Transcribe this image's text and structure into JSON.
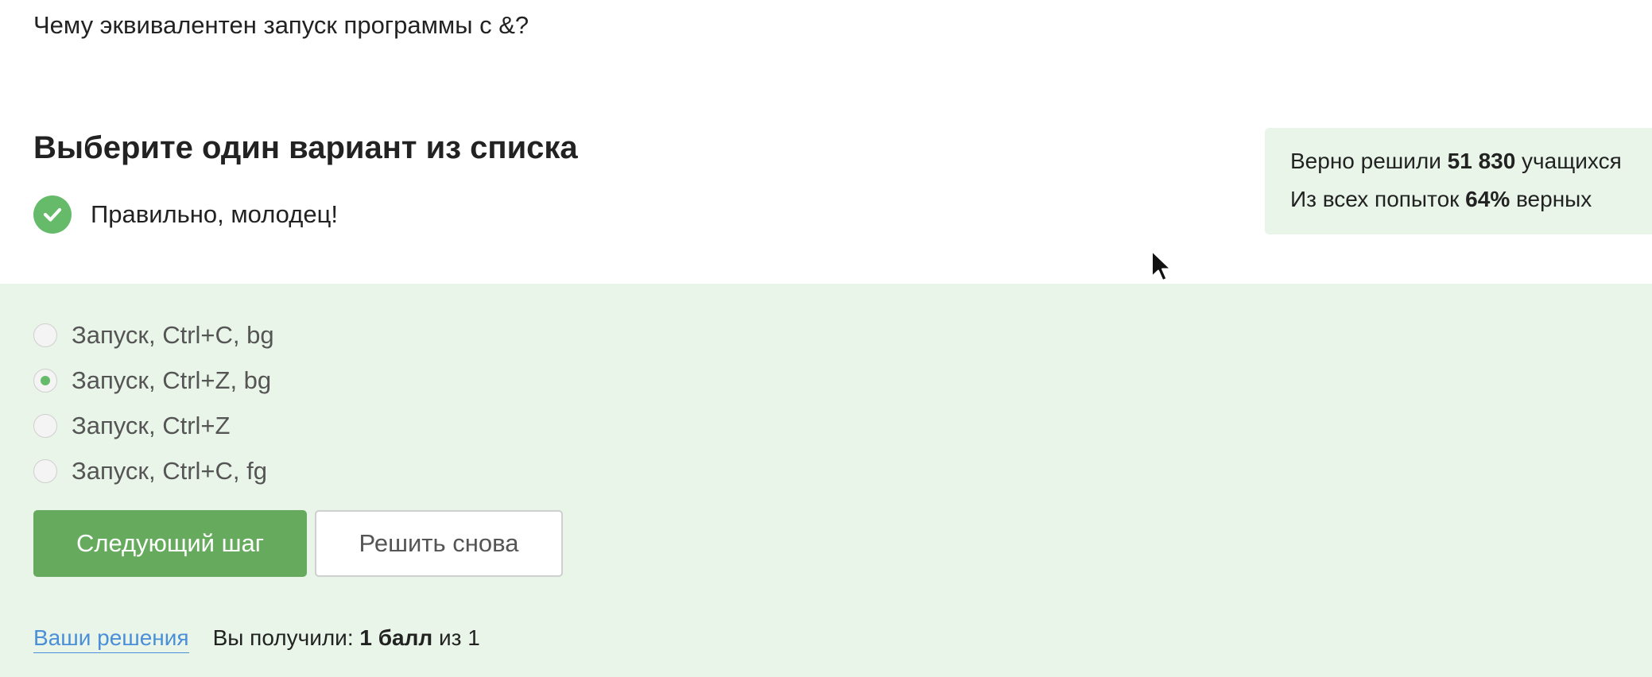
{
  "question": {
    "text": "Чему эквивалентен запуск программы с &?"
  },
  "section": {
    "title": "Выберите один вариант из списка"
  },
  "feedback": {
    "text": "Правильно, молодец!",
    "icon": "check-circle-icon",
    "color": "#66bb6a"
  },
  "stats": {
    "solved_prefix": "Верно решили ",
    "solved_count": "51 830",
    "solved_suffix": " учащихся",
    "attempts_prefix": "Из всех попыток ",
    "attempts_percent": "64%",
    "attempts_suffix": " верных"
  },
  "options": [
    {
      "label": "Запуск, Ctrl+C, bg",
      "selected": false
    },
    {
      "label": "Запуск, Ctrl+Z, bg",
      "selected": true
    },
    {
      "label": "Запуск, Ctrl+Z",
      "selected": false
    },
    {
      "label": "Запуск, Ctrl+C, fg",
      "selected": false
    }
  ],
  "buttons": {
    "next_label": "Следующий шаг",
    "retry_label": "Решить снова"
  },
  "footer": {
    "solutions_link": "Ваши решения",
    "score_prefix": "Вы получили: ",
    "score_value": "1 балл",
    "score_suffix": " из 1"
  },
  "colors": {
    "accent_green": "#66aa5e",
    "panel_background": "#e9f5e9",
    "link_blue": "#4a8fd8"
  }
}
